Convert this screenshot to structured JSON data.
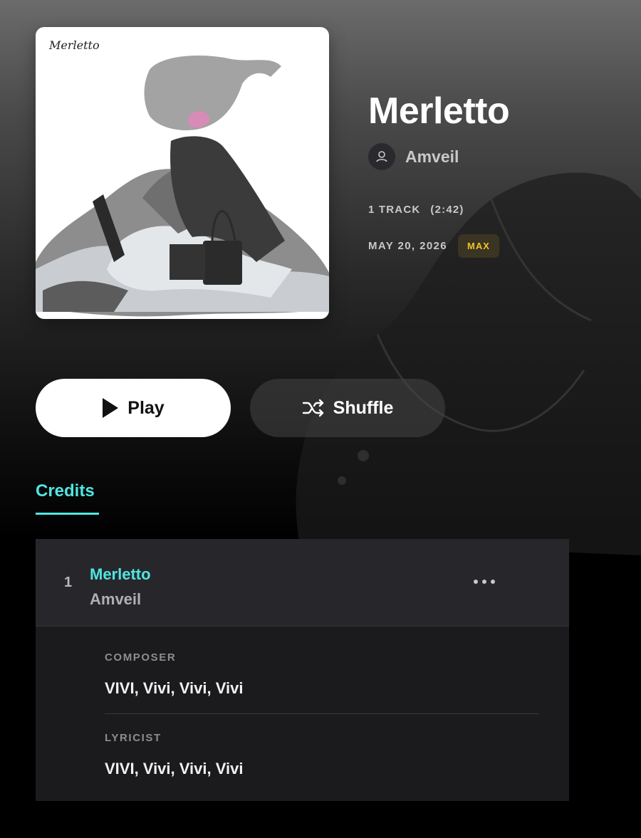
{
  "album": {
    "title": "Merletto",
    "cover_text": "Merletto",
    "artist": "Amveil",
    "track_count_label": "1 TRACK",
    "duration_label": "(2:42)",
    "release_date": "MAY 20, 2026",
    "quality_badge": "MAX"
  },
  "actions": {
    "play_label": "Play",
    "shuffle_label": "Shuffle"
  },
  "tabs": [
    {
      "label": "Credits",
      "active": true
    }
  ],
  "tracks": [
    {
      "number": "1",
      "title": "Merletto",
      "artist": "Amveil",
      "credits": [
        {
          "role": "COMPOSER",
          "names": "VIVI, Vivi, Vivi, Vivi"
        },
        {
          "role": "LYRICIST",
          "names": "VIVI, Vivi, Vivi, Vivi"
        }
      ]
    }
  ],
  "colors": {
    "accent": "#4fe6e2",
    "badge_text": "#f2c12e",
    "badge_bg": "#3a3522"
  }
}
